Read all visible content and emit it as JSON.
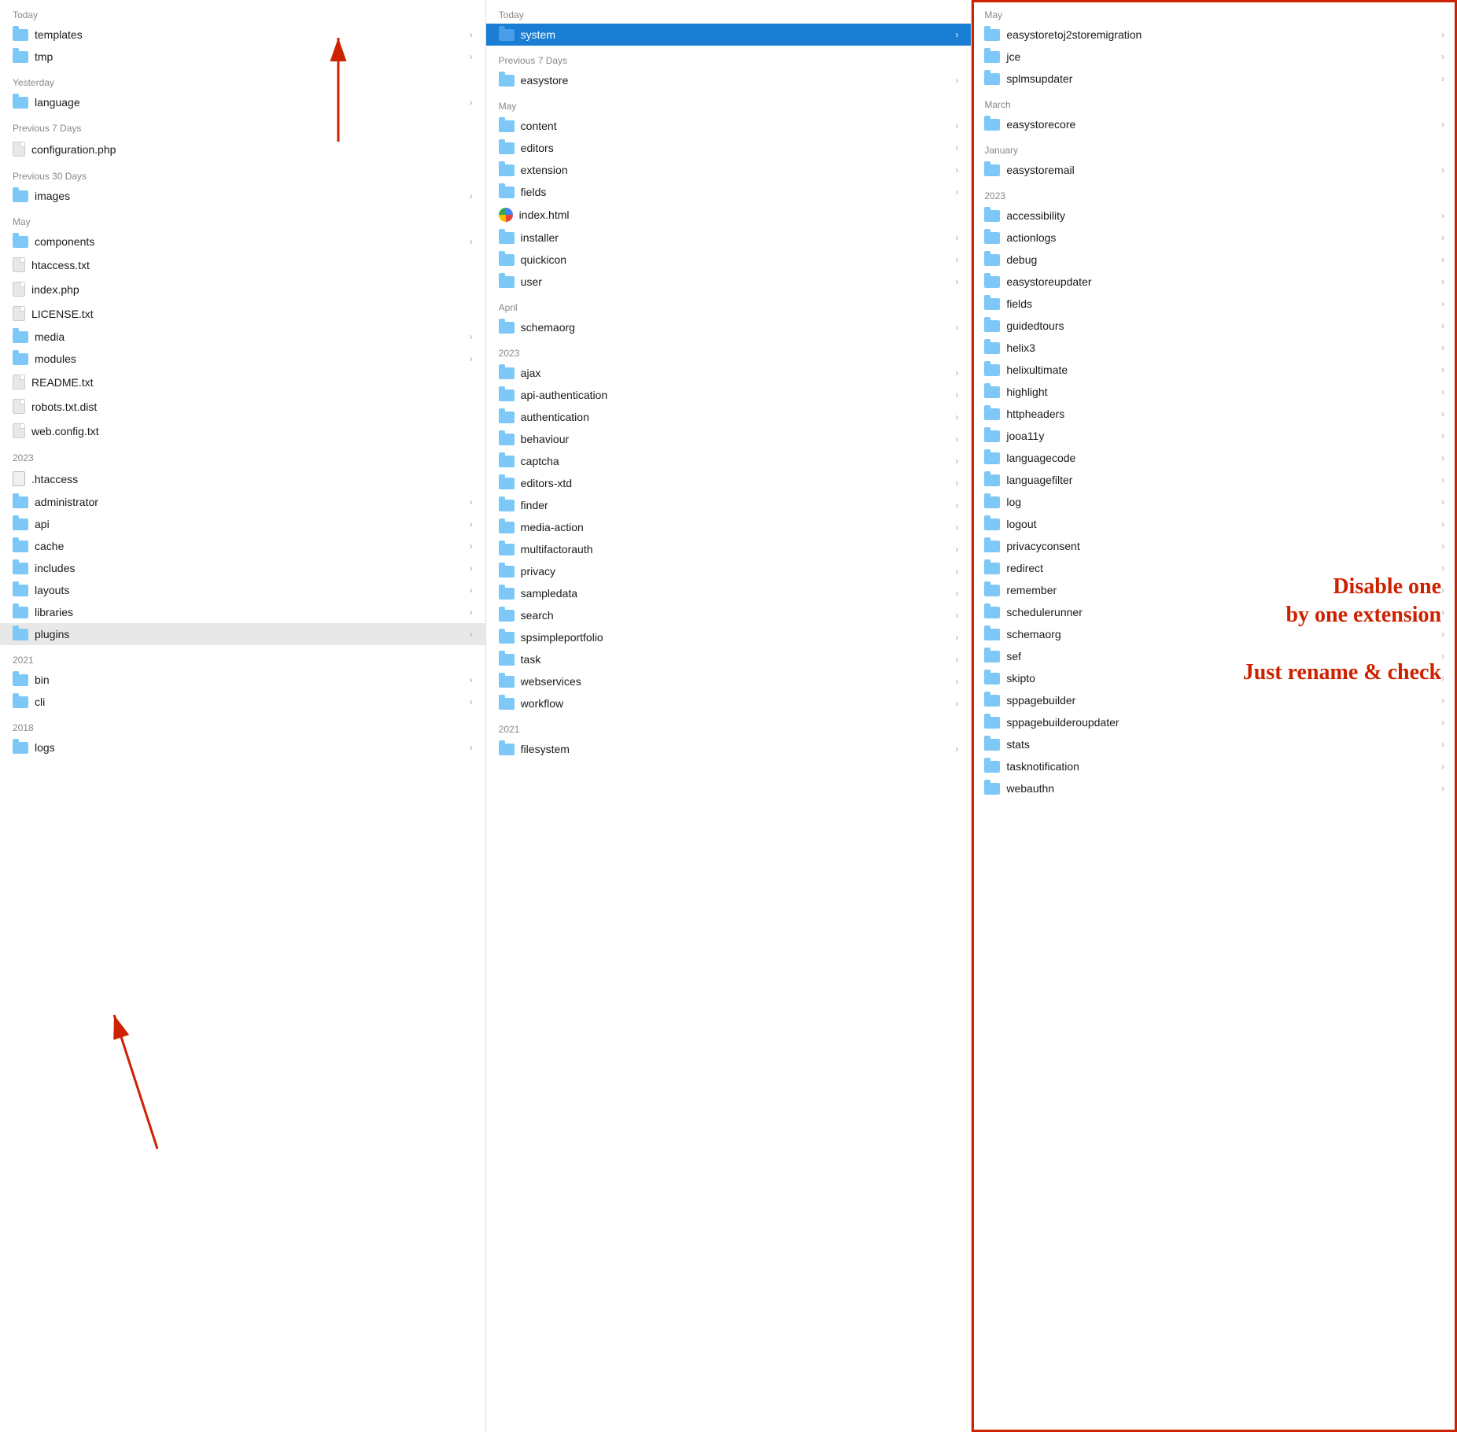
{
  "columns": {
    "col1": {
      "sections": [
        {
          "header": "Today",
          "items": [
            {
              "name": "templates",
              "type": "folder",
              "hasChevron": true
            },
            {
              "name": "tmp",
              "type": "folder",
              "hasChevron": true
            }
          ]
        },
        {
          "header": "Yesterday",
          "items": [
            {
              "name": "language",
              "type": "folder",
              "hasChevron": true
            }
          ]
        },
        {
          "header": "Previous 7 Days",
          "items": [
            {
              "name": "configuration.php",
              "type": "doc",
              "hasChevron": false
            }
          ]
        },
        {
          "header": "Previous 30 Days",
          "items": [
            {
              "name": "images",
              "type": "folder",
              "hasChevron": true
            }
          ]
        },
        {
          "header": "May",
          "items": [
            {
              "name": "components",
              "type": "folder",
              "hasChevron": true
            },
            {
              "name": "htaccess.txt",
              "type": "doc",
              "hasChevron": false
            },
            {
              "name": "index.php",
              "type": "doc",
              "hasChevron": false
            },
            {
              "name": "LICENSE.txt",
              "type": "doc",
              "hasChevron": false
            },
            {
              "name": "media",
              "type": "folder",
              "hasChevron": true
            },
            {
              "name": "modules",
              "type": "folder",
              "hasChevron": true
            },
            {
              "name": "README.txt",
              "type": "doc",
              "hasChevron": false
            },
            {
              "name": "robots.txt.dist",
              "type": "doc",
              "hasChevron": false
            },
            {
              "name": "web.config.txt",
              "type": "doc",
              "hasChevron": false
            }
          ]
        },
        {
          "header": "2023",
          "items": [
            {
              "name": ".htaccess",
              "type": "htaccess",
              "hasChevron": false
            },
            {
              "name": "administrator",
              "type": "folder",
              "hasChevron": true
            },
            {
              "name": "api",
              "type": "folder",
              "hasChevron": true
            },
            {
              "name": "cache",
              "type": "folder",
              "hasChevron": true
            },
            {
              "name": "includes",
              "type": "folder",
              "hasChevron": true
            },
            {
              "name": "layouts",
              "type": "folder",
              "hasChevron": true
            },
            {
              "name": "libraries",
              "type": "folder",
              "hasChevron": true
            },
            {
              "name": "plugins",
              "type": "folder",
              "hasChevron": true,
              "highlighted": true
            }
          ]
        },
        {
          "header": "2021",
          "items": [
            {
              "name": "bin",
              "type": "folder",
              "hasChevron": true
            },
            {
              "name": "cli",
              "type": "folder",
              "hasChevron": true
            }
          ]
        },
        {
          "header": "2018",
          "items": [
            {
              "name": "logs",
              "type": "folder",
              "hasChevron": true
            }
          ]
        }
      ]
    },
    "col2": {
      "sections": [
        {
          "header": "Today",
          "items": [
            {
              "name": "system",
              "type": "folder",
              "hasChevron": true,
              "selected": true
            }
          ]
        },
        {
          "header": "Previous 7 Days",
          "items": [
            {
              "name": "easystore",
              "type": "folder",
              "hasChevron": true
            }
          ]
        },
        {
          "header": "May",
          "items": [
            {
              "name": "content",
              "type": "folder",
              "hasChevron": true
            },
            {
              "name": "editors",
              "type": "folder",
              "hasChevron": true
            },
            {
              "name": "extension",
              "type": "folder",
              "hasChevron": true
            },
            {
              "name": "fields",
              "type": "folder",
              "hasChevron": true
            },
            {
              "name": "index.html",
              "type": "google",
              "hasChevron": false
            },
            {
              "name": "installer",
              "type": "folder",
              "hasChevron": true
            },
            {
              "name": "quickicon",
              "type": "folder",
              "hasChevron": true
            },
            {
              "name": "user",
              "type": "folder",
              "hasChevron": true
            }
          ]
        },
        {
          "header": "April",
          "items": [
            {
              "name": "schemaorg",
              "type": "folder",
              "hasChevron": true
            }
          ]
        },
        {
          "header": "2023",
          "items": [
            {
              "name": "ajax",
              "type": "folder",
              "hasChevron": true
            },
            {
              "name": "api-authentication",
              "type": "folder",
              "hasChevron": true
            },
            {
              "name": "authentication",
              "type": "folder",
              "hasChevron": true
            },
            {
              "name": "behaviour",
              "type": "folder",
              "hasChevron": true
            },
            {
              "name": "captcha",
              "type": "folder",
              "hasChevron": true
            },
            {
              "name": "editors-xtd",
              "type": "folder",
              "hasChevron": true
            },
            {
              "name": "finder",
              "type": "folder",
              "hasChevron": true
            },
            {
              "name": "media-action",
              "type": "folder",
              "hasChevron": true
            },
            {
              "name": "multifactorauth",
              "type": "folder",
              "hasChevron": true
            },
            {
              "name": "privacy",
              "type": "folder",
              "hasChevron": true
            },
            {
              "name": "sampledata",
              "type": "folder",
              "hasChevron": true
            },
            {
              "name": "search",
              "type": "folder",
              "hasChevron": true
            },
            {
              "name": "spsimpleportfolio",
              "type": "folder",
              "hasChevron": true
            },
            {
              "name": "task",
              "type": "folder",
              "hasChevron": true
            },
            {
              "name": "webservices",
              "type": "folder",
              "hasChevron": true
            },
            {
              "name": "workflow",
              "type": "folder",
              "hasChevron": true
            }
          ]
        },
        {
          "header": "2021",
          "items": [
            {
              "name": "filesystem",
              "type": "folder",
              "hasChevron": true
            }
          ]
        }
      ]
    },
    "col3": {
      "sections": [
        {
          "header": "May",
          "items": [
            {
              "name": "easystoretoj2storemigration",
              "type": "folder",
              "hasChevron": true
            },
            {
              "name": "jce",
              "type": "folder",
              "hasChevron": true
            },
            {
              "name": "splmsupdater",
              "type": "folder",
              "hasChevron": true
            }
          ]
        },
        {
          "header": "March",
          "items": [
            {
              "name": "easystorecore",
              "type": "folder",
              "hasChevron": true
            }
          ]
        },
        {
          "header": "January",
          "items": [
            {
              "name": "easystoremail",
              "type": "folder",
              "hasChevron": true
            }
          ]
        },
        {
          "header": "2023",
          "items": [
            {
              "name": "accessibility",
              "type": "folder",
              "hasChevron": true
            },
            {
              "name": "actionlogs",
              "type": "folder",
              "hasChevron": true
            },
            {
              "name": "debug",
              "type": "folder",
              "hasChevron": true
            },
            {
              "name": "easystoreupdater",
              "type": "folder",
              "hasChevron": true
            },
            {
              "name": "fields",
              "type": "folder",
              "hasChevron": true
            },
            {
              "name": "guidedtours",
              "type": "folder",
              "hasChevron": true
            },
            {
              "name": "helix3",
              "type": "folder",
              "hasChevron": true
            },
            {
              "name": "helixultimate",
              "type": "folder",
              "hasChevron": true
            },
            {
              "name": "highlight",
              "type": "folder",
              "hasChevron": true
            },
            {
              "name": "httpheaders",
              "type": "folder",
              "hasChevron": true
            },
            {
              "name": "jooa11y",
              "type": "folder",
              "hasChevron": true
            },
            {
              "name": "languagecode",
              "type": "folder",
              "hasChevron": true
            },
            {
              "name": "languagefilter",
              "type": "folder",
              "hasChevron": true
            },
            {
              "name": "log",
              "type": "folder",
              "hasChevron": true
            },
            {
              "name": "logout",
              "type": "folder",
              "hasChevron": true
            },
            {
              "name": "privacyconsent",
              "type": "folder",
              "hasChevron": true
            },
            {
              "name": "redirect",
              "type": "folder",
              "hasChevron": true
            },
            {
              "name": "remember",
              "type": "folder",
              "hasChevron": true
            },
            {
              "name": "schedulerunner",
              "type": "folder",
              "hasChevron": true
            },
            {
              "name": "schemaorg",
              "type": "folder",
              "hasChevron": true
            },
            {
              "name": "sef",
              "type": "folder",
              "hasChevron": true
            },
            {
              "name": "skipto",
              "type": "folder",
              "hasChevron": true
            },
            {
              "name": "sppagebuilder",
              "type": "folder",
              "hasChevron": true
            },
            {
              "name": "sppagebuilderoupdater",
              "type": "folder",
              "hasChevron": true
            },
            {
              "name": "stats",
              "type": "folder",
              "hasChevron": true
            },
            {
              "name": "tasknotification",
              "type": "folder",
              "hasChevron": true
            },
            {
              "name": "webauthn",
              "type": "folder",
              "hasChevron": true
            }
          ]
        }
      ],
      "annotation": {
        "line1": "Disable one",
        "line2": "by one extension",
        "line3": "",
        "line4": "Just rename & check"
      }
    }
  },
  "arrows": [
    {
      "id": "arrow1",
      "description": "Arrow pointing to system folder"
    },
    {
      "id": "arrow2",
      "description": "Arrow pointing to plugins folder"
    }
  ]
}
